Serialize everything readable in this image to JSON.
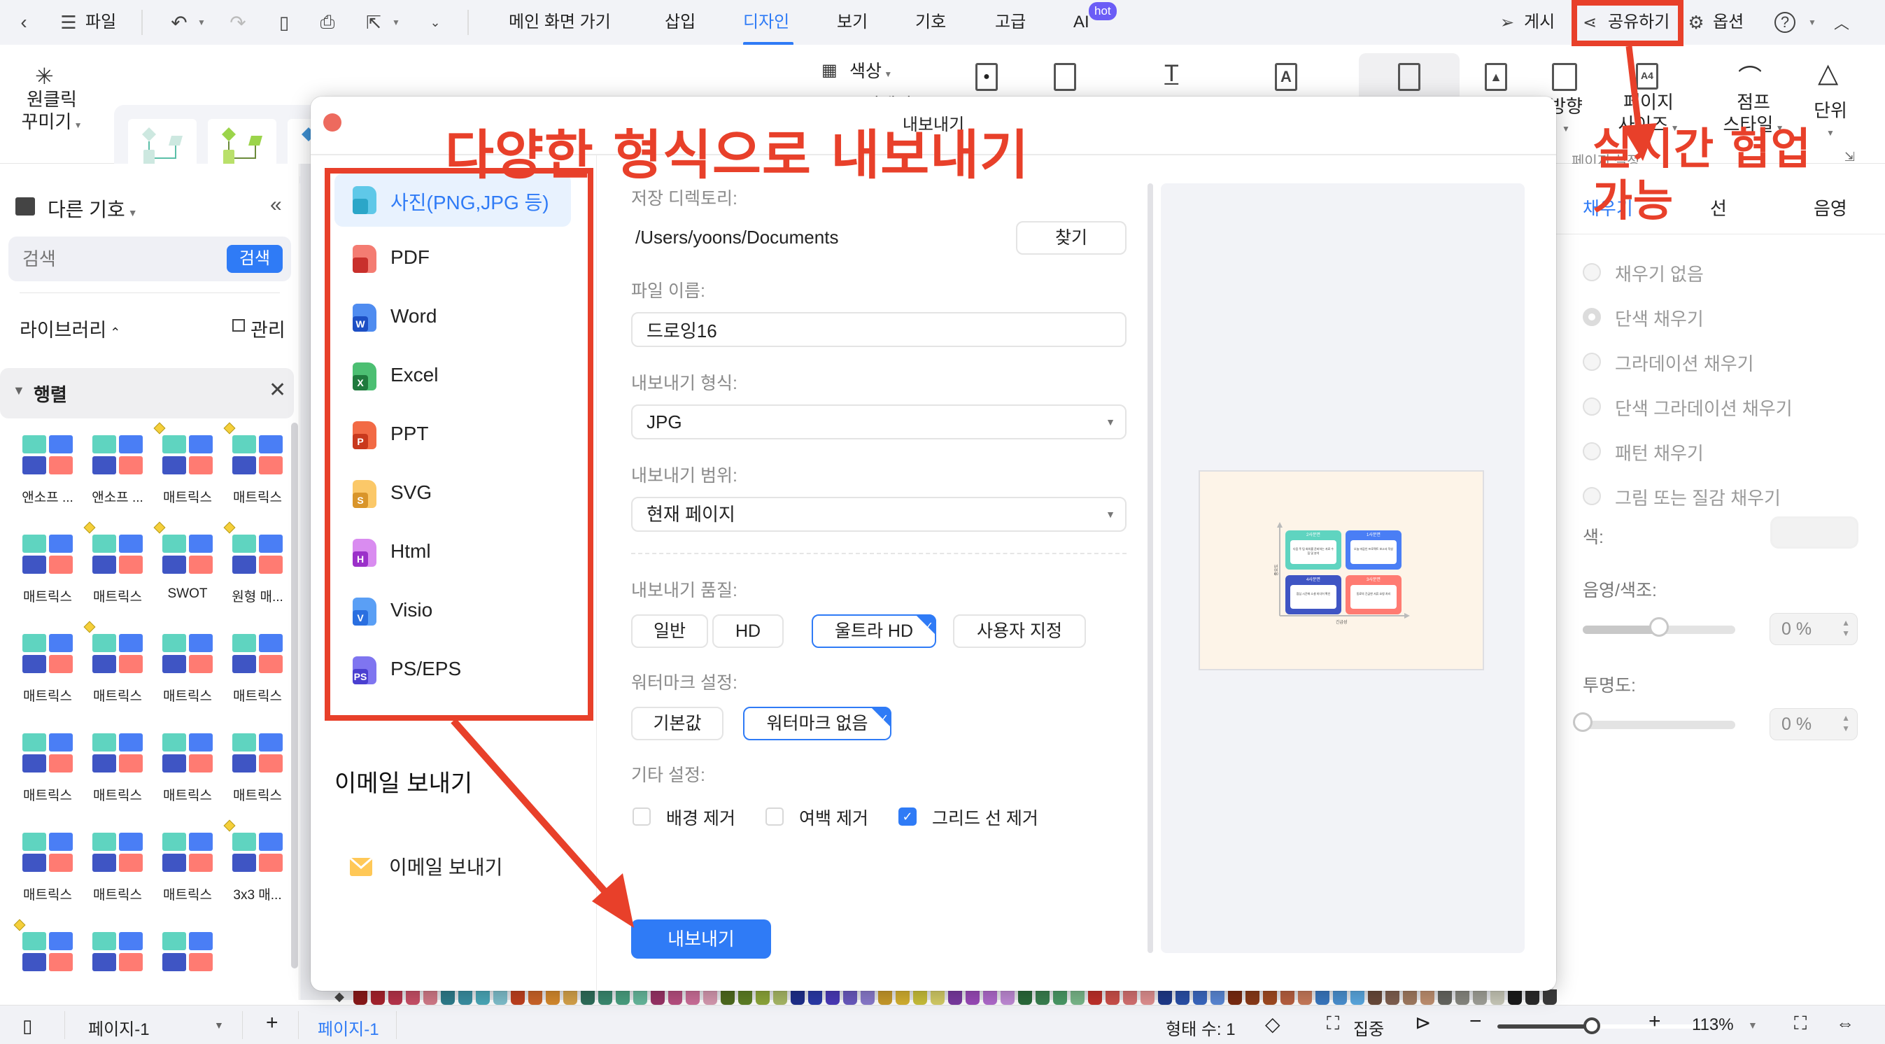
{
  "menubar": {
    "file": "파일",
    "tabs": [
      {
        "label": "메인 화면 가기",
        "active": false
      },
      {
        "label": "삽입",
        "active": false
      },
      {
        "label": "디자인",
        "active": true
      },
      {
        "label": "보기",
        "active": false
      },
      {
        "label": "기호",
        "active": false
      },
      {
        "label": "고급",
        "active": false
      },
      {
        "label": "AI",
        "active": false,
        "badge": "hot"
      }
    ],
    "publish": "게시",
    "share": "공유하기",
    "options": "옵션",
    "help": "?",
    "accent": "#2f7bf6"
  },
  "ribbon": {
    "one_click_line1": "원클릭",
    "one_click_line2": "꾸미기",
    "color_label": "색상",
    "color_sub": "커넥터",
    "page_direction": "방향",
    "page_size_line1": "페이지",
    "page_size_line2": "사이즈",
    "jump_style_line1": "점프",
    "jump_style_line2": "스타일",
    "unit": "단위",
    "page_settings_group": "페이지 설정"
  },
  "sidebar": {
    "header": "다른 기호",
    "search_placeholder": "검색",
    "search_button": "검색",
    "library": "라이브러리",
    "manage": "관리",
    "section": "행렬",
    "thumbnails": [
      {
        "label": "앤소프 ...",
        "premium": false
      },
      {
        "label": "앤소프 ...",
        "premium": false
      },
      {
        "label": "매트릭스",
        "premium": true
      },
      {
        "label": "매트릭스",
        "premium": true
      },
      {
        "label": "매트릭스",
        "premium": false
      },
      {
        "label": "매트릭스",
        "premium": true
      },
      {
        "label": "SWOT",
        "premium": true
      },
      {
        "label": "원형 매...",
        "premium": true
      },
      {
        "label": "매트릭스",
        "premium": false
      },
      {
        "label": "매트릭스",
        "premium": true
      },
      {
        "label": "매트릭스",
        "premium": false
      },
      {
        "label": "매트릭스",
        "premium": false
      },
      {
        "label": "매트릭스",
        "premium": false
      },
      {
        "label": "매트릭스",
        "premium": false
      },
      {
        "label": "매트릭스",
        "premium": false
      },
      {
        "label": "매트릭스",
        "premium": false
      },
      {
        "label": "매트릭스",
        "premium": false
      },
      {
        "label": "매트릭스",
        "premium": false
      },
      {
        "label": "매트릭스",
        "premium": false
      },
      {
        "label": "3x3 매...",
        "premium": true
      },
      {
        "label": "",
        "premium": true
      },
      {
        "label": "",
        "premium": false
      },
      {
        "label": "",
        "premium": false
      }
    ]
  },
  "dialog": {
    "title": "내보내기",
    "formats": [
      {
        "label": "사진(PNG,JPG 등)",
        "badge": "",
        "color": "#5fc8e8",
        "badge_color": "#2ba6c8",
        "selected": true
      },
      {
        "label": "PDF",
        "badge": "",
        "color": "#f47c72",
        "badge_color": "#c9302c",
        "selected": false
      },
      {
        "label": "Word",
        "badge": "W",
        "color": "#4f8cf0",
        "badge_color": "#1d4fc4",
        "selected": false
      },
      {
        "label": "Excel",
        "badge": "X",
        "color": "#4cbf72",
        "badge_color": "#1f7a3d",
        "selected": false
      },
      {
        "label": "PPT",
        "badge": "P",
        "color": "#f26a45",
        "badge_color": "#c9391d",
        "selected": false
      },
      {
        "label": "SVG",
        "badge": "S",
        "color": "#fbc868",
        "badge_color": "#d9952a",
        "selected": false
      },
      {
        "label": "Html",
        "badge": "H",
        "color": "#d98cf0",
        "badge_color": "#9b30c9",
        "selected": false
      },
      {
        "label": "Visio",
        "badge": "V",
        "color": "#5a9ff5",
        "badge_color": "#2a6fe0",
        "selected": false
      },
      {
        "label": "PS/EPS",
        "badge": "PS",
        "color": "#7f75f0",
        "badge_color": "#4a3fd0",
        "selected": false
      }
    ],
    "email_heading": "이메일 보내기",
    "email_item": "이메일 보내기",
    "save_dir_label": "저장 디렉토리:",
    "save_dir_value": "/Users/yoons/Documents",
    "browse": "찾기",
    "filename_label": "파일 이름:",
    "filename_value": "드로잉16",
    "format_label": "내보내기 형식:",
    "format_value": "JPG",
    "range_label": "내보내기 범위:",
    "range_value": "현재 페이지",
    "quality_label": "내보내기 품질:",
    "quality_options": [
      {
        "label": "일반",
        "selected": false
      },
      {
        "label": "HD",
        "selected": false
      },
      {
        "label": "울트라 HD",
        "selected": true
      },
      {
        "label": "사용자 지정",
        "selected": false
      }
    ],
    "watermark_label": "워터마크 설정:",
    "watermark_options": [
      {
        "label": "기본값",
        "selected": false
      },
      {
        "label": "워터마크 없음",
        "selected": true
      }
    ],
    "other_label": "기타 설정:",
    "other_options": [
      {
        "label": "배경 제거",
        "checked": false
      },
      {
        "label": "여백 제거",
        "checked": false
      },
      {
        "label": "그리드 선 제거",
        "checked": true
      }
    ],
    "export_button": "내보내기",
    "preview": {
      "y_axis": "중요도",
      "x_axis": "긴급성",
      "quadrants": [
        {
          "title": "2사분면",
          "text": "다음 주 팀 회의를 준비하는 자료 수집 및 분석",
          "color": "#5fd4c0"
        },
        {
          "title": "1사분면",
          "text": "오늘 마감인 프로젝트 보고서 작성",
          "color": "#4a7ef5"
        },
        {
          "title": "4사분면",
          "text": "점심 시간에 소셜 미디어 확인",
          "color": "#3f55c4"
        },
        {
          "title": "3사분면",
          "text": "동료의 긴급한 서류 요청 처리",
          "color": "#ff7b72"
        }
      ]
    }
  },
  "right_panel": {
    "tabs": [
      {
        "label": "채우기",
        "active": true
      },
      {
        "label": "선",
        "active": false
      },
      {
        "label": "음영",
        "active": false
      }
    ],
    "fill_options": [
      {
        "label": "채우기 없음",
        "selected": false
      },
      {
        "label": "단색 채우기",
        "selected": true
      },
      {
        "label": "그라데이션 채우기",
        "selected": false
      },
      {
        "label": "단색 그라데이션 채우기",
        "selected": false
      },
      {
        "label": "패턴 채우기",
        "selected": false
      },
      {
        "label": "그림 또는 질감 채우기",
        "selected": false
      }
    ],
    "color_label": "색:",
    "shade_label": "음영/색조:",
    "shade_value": "0 %",
    "shade_slider": 0.5,
    "transparency_label": "투명도:",
    "transparency_value": "0 %",
    "transparency_slider": 0
  },
  "statusbar": {
    "page_selector": "페이지-1",
    "add_page": "+",
    "active_page_tab": "페이지-1",
    "shape_count": "형태 수: 1",
    "focus": "집중",
    "zoom": "113%",
    "zoom_slider": 0.45
  },
  "annotations": {
    "export_caption": "다양한 형식으로 내보내기",
    "collab_line1": "실시간 협업",
    "collab_line2": "가능",
    "color": "#e8402a"
  },
  "palette": [
    "#8b1a1a",
    "#a8232e",
    "#b8344b",
    "#c95067",
    "#d27a88",
    "#2e7d8c",
    "#3a8fa2",
    "#4aa8b8",
    "#7fbfcc",
    "#c0401f",
    "#cc6428",
    "#d68a2e",
    "#d6a24a",
    "#2f6e5a",
    "#3b8a70",
    "#4aa080",
    "#66b89c",
    "#993366",
    "#b84f80",
    "#cc6f99",
    "#d699b0",
    "#4f6b1f",
    "#5e7f25",
    "#8da63a",
    "#a8b866",
    "#1f2f8c",
    "#2a3aa8",
    "#4a3ab8",
    "#6a5abf",
    "#8a7acc",
    "#c89a2a",
    "#d4b030",
    "#c9bf3a",
    "#d4cc66",
    "#7a3aa0",
    "#9a4ab8",
    "#b06acc",
    "#c08ad6",
    "#2a6a3a",
    "#3a8050",
    "#4a9a66",
    "#7ab88a",
    "#c0302a",
    "#cc504a",
    "#d47070",
    "#e09090",
    "#1f3a8a",
    "#2a50a8",
    "#3a68c0",
    "#5a88d6",
    "#7a2a10",
    "#8a3a18",
    "#a04a20",
    "#b86040",
    "#c87a5a",
    "#3a78c0",
    "#4a90d0",
    "#5aa8e0",
    "#6a4a3a",
    "#806050",
    "#a07a60",
    "#c09070",
    "#666660",
    "#888880",
    "#a0a098",
    "#c8c8b8",
    "#1a1a1a",
    "#2a2a2a",
    "#3a3a3a",
    "#555555",
    "#777777",
    "#999999",
    "#bbbbbb",
    "#dddddd"
  ]
}
